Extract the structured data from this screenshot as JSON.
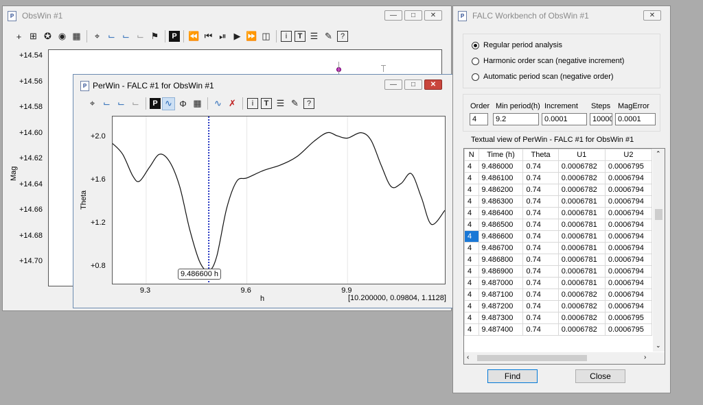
{
  "obswin": {
    "title": "ObsWin #1",
    "y_ticks": [
      "+14.54",
      "+14.56",
      "+14.58",
      "+14.60",
      "+14.62",
      "+14.64",
      "+14.66",
      "+14.68",
      "+14.70"
    ],
    "ylabel": "Mag",
    "toolbar_icons": [
      "crosshair-icon",
      "grid-icon",
      "star-icon",
      "dial-icon",
      "image-icon",
      "fit-icon",
      "axes-icon",
      "axes-icon-2",
      "axes-icon-3",
      "flag-icon",
      "p-icon",
      "rewind-icon",
      "prev-icon",
      "pause-icon",
      "play-icon",
      "forward-icon",
      "trash-icon",
      "info-icon",
      "text-icon",
      "list-icon",
      "edit-icon",
      "help-icon"
    ]
  },
  "perwin": {
    "title": "PerWin - FALC #1 for ObsWin #1",
    "ylabel": "Theta",
    "xlabel": "h",
    "y_ticks": [
      "+2.0",
      "+1.6",
      "+1.2",
      "+0.8"
    ],
    "x_ticks": [
      "9.3",
      "9.6",
      "9.9"
    ],
    "cursor_label": "9.486600 h",
    "status": "[10.200000, 0.09804, 1.1128]"
  },
  "chart_data": {
    "type": "line",
    "title": "",
    "xlabel": "h",
    "ylabel": "Theta",
    "xlim": [
      9.2,
      10.19
    ],
    "ylim": [
      0.65,
      2.2
    ],
    "x": [
      9.2,
      9.23,
      9.26,
      9.28,
      9.31,
      9.34,
      9.37,
      9.4,
      9.43,
      9.46,
      9.4866,
      9.51,
      9.54,
      9.57,
      9.6,
      9.65,
      9.7,
      9.75,
      9.8,
      9.84,
      9.87,
      9.9,
      9.94,
      9.97,
      10.0,
      10.03,
      10.06,
      10.09,
      10.12,
      10.15,
      10.19
    ],
    "y": [
      1.95,
      1.85,
      1.65,
      1.6,
      1.73,
      1.85,
      1.78,
      1.55,
      1.15,
      0.85,
      0.77,
      0.9,
      1.35,
      1.6,
      1.63,
      1.7,
      1.75,
      1.83,
      1.97,
      2.05,
      2.02,
      2.0,
      2.05,
      1.98,
      1.75,
      1.55,
      1.58,
      1.67,
      1.45,
      1.2,
      1.33
    ],
    "cursor_x": 9.4866
  },
  "workbench": {
    "title": "FALC Workbench of ObsWin #1",
    "options": [
      {
        "label": "Regular period analysis",
        "checked": true
      },
      {
        "label": "Harmonic order scan (negative increment)",
        "checked": false
      },
      {
        "label": "Automatic period scan (negative order)",
        "checked": false
      }
    ],
    "params": {
      "order_label": "Order",
      "order": "4",
      "minperiod_label": "Min period(h)",
      "minperiod": "9.2",
      "increment_label": "Increment",
      "increment": "0.0001",
      "steps_label": "Steps",
      "steps": "10000",
      "magerror_label": "MagError",
      "magerror": "0.0001"
    },
    "textual_label": "Textual view of PerWin - FALC #1 for ObsWin #1",
    "columns": [
      "N",
      "Time (h)",
      "Theta",
      "U1",
      "U2"
    ],
    "rows": [
      [
        "4",
        "9.486000",
        "0.74",
        "0.0006782",
        "0.0006795"
      ],
      [
        "4",
        "9.486100",
        "0.74",
        "0.0006782",
        "0.0006794"
      ],
      [
        "4",
        "9.486200",
        "0.74",
        "0.0006782",
        "0.0006794"
      ],
      [
        "4",
        "9.486300",
        "0.74",
        "0.0006781",
        "0.0006794"
      ],
      [
        "4",
        "9.486400",
        "0.74",
        "0.0006781",
        "0.0006794"
      ],
      [
        "4",
        "9.486500",
        "0.74",
        "0.0006781",
        "0.0006794"
      ],
      [
        "4",
        "9.486600",
        "0.74",
        "0.0006781",
        "0.0006794"
      ],
      [
        "4",
        "9.486700",
        "0.74",
        "0.0006781",
        "0.0006794"
      ],
      [
        "4",
        "9.486800",
        "0.74",
        "0.0006781",
        "0.0006794"
      ],
      [
        "4",
        "9.486900",
        "0.74",
        "0.0006781",
        "0.0006794"
      ],
      [
        "4",
        "9.487000",
        "0.74",
        "0.0006781",
        "0.0006794"
      ],
      [
        "4",
        "9.487100",
        "0.74",
        "0.0006782",
        "0.0006794"
      ],
      [
        "4",
        "9.487200",
        "0.74",
        "0.0006782",
        "0.0006794"
      ],
      [
        "4",
        "9.487300",
        "0.74",
        "0.0006782",
        "0.0006795"
      ],
      [
        "4",
        "9.487400",
        "0.74",
        "0.0006782",
        "0.0006795"
      ]
    ],
    "selected_row": 6,
    "find_label": "Find",
    "close_label": "Close"
  }
}
